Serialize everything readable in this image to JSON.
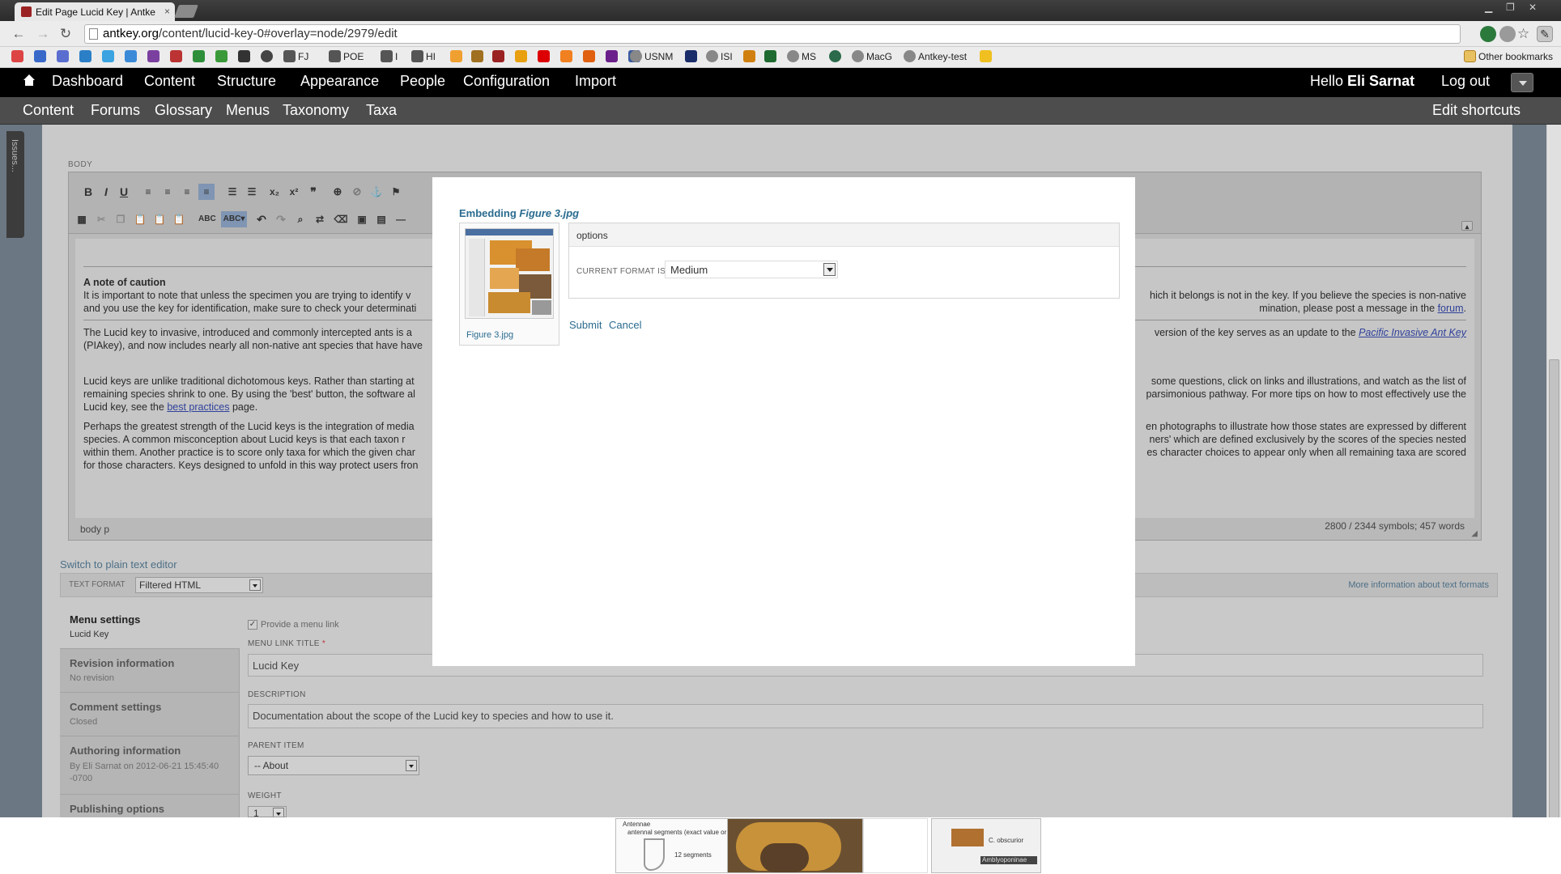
{
  "browser": {
    "tab_title": "Edit Page Lucid Key | Antke",
    "tab_close": "×",
    "url_host": "antkey.org",
    "url_path": "/content/lucid-key-0#overlay=node/2979/edit",
    "bookmarks": [
      "FJ",
      "POE",
      "I",
      "HI",
      "USNM",
      "ISI",
      "MS",
      "MacG",
      "Antkey-test"
    ],
    "other_bookmarks": "Other bookmarks"
  },
  "admin_bar": {
    "items": [
      "Dashboard",
      "Content",
      "Structure",
      "Appearance",
      "People",
      "Configuration",
      "Import"
    ],
    "hello": "Hello",
    "user": "Eli Sarnat",
    "logout": "Log out"
  },
  "shortcuts": {
    "items": [
      "Content",
      "Forums",
      "Glossary",
      "Menus",
      "Taxonomy",
      "Taxa"
    ],
    "edit": "Edit shortcuts"
  },
  "issues_tab": "Issues...",
  "editor": {
    "label": "BODY",
    "heading": "A note of caution",
    "para1_left": "It is important to note that unless the specimen you are trying to identify v",
    "para1_right": "hich it belongs is not in the key. If you believe the species is non-native",
    "para1b_left": "and you use the key for identification, make sure to check your determinati",
    "para1b_right": "mination, please post a message in the",
    "para1b_link": "forum",
    "para2_left": "The Lucid key to invasive, introduced and commonly intercepted ants is a",
    "para2_right": "version of the key serves as an update to the",
    "para2_link": "Pacific Invasive Ant Key",
    "para2b_left": "(PIAkey), and now includes nearly all non-native ant species that have have",
    "para3_left": "Lucid keys are unlike traditional dichotomous keys. Rather than starting at",
    "para3_right": "some questions, click on links and illustrations, and watch as the list of",
    "para3b_left": "remaining species shrink to one. By using the 'best' button, the software al",
    "para3b_right": "parsimonious pathway. For more tips on how to most effectively use the",
    "para3c_left": "Lucid key, see the",
    "para3c_link": "best practices",
    "para3c_after": "page.",
    "para4_left": "Perhaps the greatest strength of the Lucid keys is the integration of media",
    "para4_right": "en photographs to illustrate how those states are expressed by different",
    "para4b_left": "species. A common misconception about Lucid keys is that each taxon r",
    "para4b_right": "ners' which are defined exclusively by the scores of the species nested",
    "para4c_left": "within them. Another practice is to score only taxa for which the given char",
    "para4c_right": "es character choices to appear only when all remaining taxa are scored",
    "para4d_left": "for those characters. Keys designed to unfold in this way protect users fron",
    "status_path": "body  p",
    "status_count": "2800 / 2344 symbols; 457 words"
  },
  "below": {
    "switch_editor": "Switch to plain text editor",
    "text_format_label": "TEXT FORMAT",
    "text_format_value": "Filtered HTML",
    "more_info": "More information about text formats"
  },
  "vtabs": [
    {
      "title": "Menu settings",
      "summary": "Lucid Key"
    },
    {
      "title": "Revision information",
      "summary": "No revision"
    },
    {
      "title": "Comment settings",
      "summary": "Closed"
    },
    {
      "title": "Authoring information",
      "summary": "By Eli Sarnat on 2012-06-21 15:45:40 -0700"
    },
    {
      "title": "Publishing options",
      "summary": ""
    }
  ],
  "menu_settings": {
    "provide_link": "Provide a menu link",
    "link_title_label": "MENU LINK TITLE",
    "required": "*",
    "link_title_value": "Lucid Key",
    "description_label": "DESCRIPTION",
    "description_value": "Documentation about the scope of the Lucid key to species and how to use it.",
    "parent_label": "PARENT ITEM",
    "parent_value": "-- About",
    "weight_label": "WEIGHT",
    "weight_value": "1"
  },
  "modal": {
    "title_prefix": "Embedding",
    "title_file": "Figure 3.jpg",
    "thumb_caption": "Figure 3.jpg",
    "options_heading": "options",
    "current_format_label": "CURRENT FORMAT IS",
    "current_format_value": "Medium",
    "submit": "Submit",
    "cancel": "Cancel"
  },
  "bottom_strip": {
    "t1": "Antennae",
    "t2": "antennal segments (exact value or rang",
    "t3": "12   segments",
    "t4": "C. obscurior",
    "t5": "Amblyoponinae"
  }
}
